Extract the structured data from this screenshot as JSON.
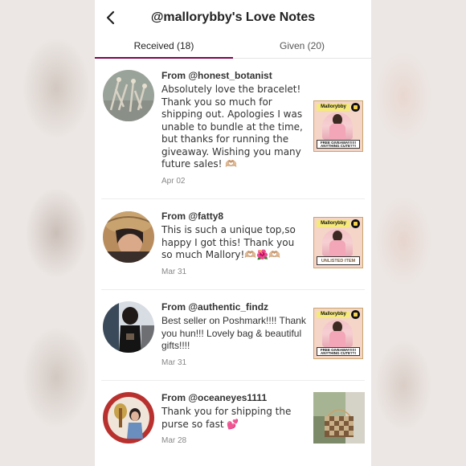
{
  "header": {
    "title": "@mallorybby's Love Notes",
    "back_icon": "chevron-left-icon"
  },
  "tabs": [
    {
      "label": "Received (18)",
      "active": true
    },
    {
      "label": "Given (20)",
      "active": false
    }
  ],
  "notes": [
    {
      "from": "From @honest_botanist",
      "message": "Absolutely love the bracelet! Thank you so much for shipping out. Apologies I was unable to bundle at the time, but thanks for running the giveaway. Wishing you many future sales! 🫶🏼",
      "date": "Apr 02",
      "thumb": {
        "top": "Mallorybby",
        "bottom": "FREE GIVEAWAY!!!!! ANYTHING CUTE??!"
      }
    },
    {
      "from": "From @fatty8",
      "message": "This is such a unique top,so happy I got this! Thank you so much Mallory!🫶🏼🌺🫶🏼",
      "date": "Mar 31",
      "thumb": {
        "top": "Mallorybby",
        "bottom": "UNLISTED ITEM"
      }
    },
    {
      "from": "From @authentic_findz",
      "message": "Best seller on Poshmark!!!! Thank you hun!!! Lovely bag & beautiful gifts!!!!",
      "date": "Mar 31",
      "thumb": {
        "top": "Mallorybby",
        "bottom": "FREE GIVEAWAY!!!!! ANYTHING CUTE??!"
      }
    },
    {
      "from": "From @oceaneyes1111",
      "message": "Thank you for shipping the purse so fast 💕",
      "date": "Mar 28",
      "thumb": null
    }
  ],
  "colors": {
    "tab_indicator": "#7f0353",
    "background": "#ffffff"
  }
}
